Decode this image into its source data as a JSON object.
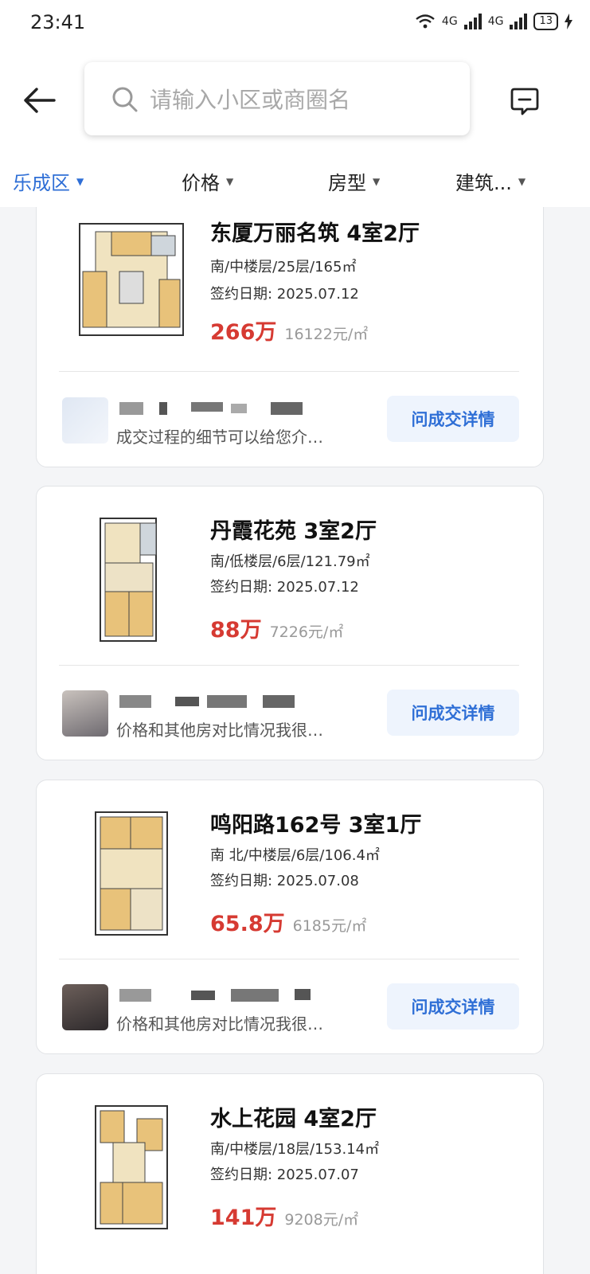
{
  "status_bar": {
    "time": "23:41",
    "signal1": "4G",
    "signal2": "4G",
    "battery": "13"
  },
  "search": {
    "placeholder": "请输入小区或商圈名"
  },
  "filters": [
    {
      "label": "乐成区",
      "active": true
    },
    {
      "label": "价格",
      "active": false
    },
    {
      "label": "房型",
      "active": false
    },
    {
      "label": "建筑...",
      "active": false
    }
  ],
  "listings": [
    {
      "title": "东厦万丽名筑 4室2厅",
      "details": "南/中楼层/25层/165㎡",
      "date": "签约日期:  2025.07.12",
      "price": "266万",
      "unit_price": "16122元/㎡",
      "agent_message": "成交过程的细节可以给您介…",
      "action": "问成交详情"
    },
    {
      "title": "丹霞花苑 3室2厅",
      "details": "南/低楼层/6层/121.79㎡",
      "date": "签约日期:  2025.07.12",
      "price": "88万",
      "unit_price": "7226元/㎡",
      "agent_message": "价格和其他房对比情况我很…",
      "action": "问成交详情"
    },
    {
      "title": "鸣阳路162号 3室1厅",
      "details": "南 北/中楼层/6层/106.4㎡",
      "date": "签约日期:  2025.07.08",
      "price": "65.8万",
      "unit_price": "6185元/㎡",
      "agent_message": "价格和其他房对比情况我很…",
      "action": "问成交详情"
    },
    {
      "title": "水上花园 4室2厅",
      "details": "南/中楼层/18层/153.14㎡",
      "date": "签约日期:  2025.07.07",
      "price": "141万",
      "unit_price": "9208元/㎡"
    }
  ],
  "colors": {
    "accent": "#2f6fd6",
    "price": "#d63a32"
  }
}
